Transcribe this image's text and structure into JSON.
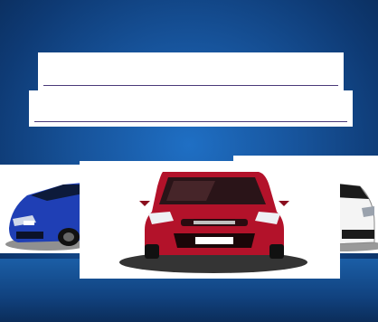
{
  "hero": {
    "heading_line_1": "",
    "heading_line_2": ""
  },
  "colors": {
    "background": "#17549c",
    "card_bg": "#ffffff",
    "underline": "#4a3a7a",
    "car_left": "#1f3fb5",
    "car_center": "#b3122a",
    "car_right": "#f2f2f2"
  },
  "cars": [
    {
      "name": "blue-hatchback"
    },
    {
      "name": "red-hatchback"
    },
    {
      "name": "white-hatchback"
    }
  ]
}
